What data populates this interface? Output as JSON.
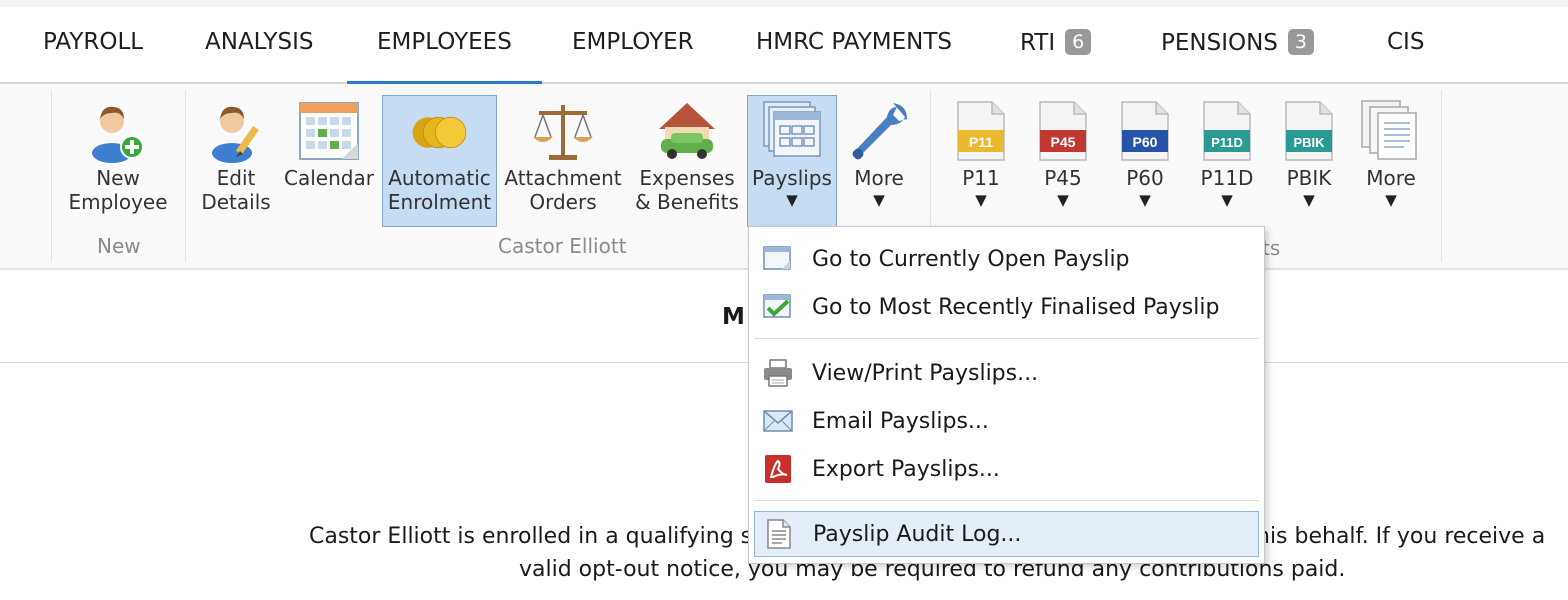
{
  "tabs": [
    {
      "label": "PAYROLL"
    },
    {
      "label": "ANALYSIS"
    },
    {
      "label": "EMPLOYEES",
      "active": true
    },
    {
      "label": "EMPLOYER"
    },
    {
      "label": "HMRC PAYMENTS"
    },
    {
      "label": "RTI",
      "badge": "6"
    },
    {
      "label": "PENSIONS",
      "badge": "3"
    },
    {
      "label": "CIS"
    }
  ],
  "ribbon": {
    "new_employee": {
      "line1": "New",
      "line2": "Employee"
    },
    "edit_details": {
      "line1": "Edit",
      "line2": "Details"
    },
    "calendar": {
      "line1": "Calendar"
    },
    "automatic_enrolment": {
      "line1": "Automatic",
      "line2": "Enrolment"
    },
    "attachment_orders": {
      "line1": "Attachment",
      "line2": "Orders"
    },
    "expenses_benefits": {
      "line1": "Expenses",
      "line2": "& Benefits"
    },
    "payslips": {
      "line1": "Payslips",
      "arrow": "▼"
    },
    "more1": {
      "line1": "More",
      "arrow": "▼"
    },
    "p11": {
      "line1": "P11",
      "icon_text": "P11",
      "color": "#e9b92e",
      "arrow": "▼"
    },
    "p45": {
      "line1": "P45",
      "icon_text": "P45",
      "color": "#c0382f",
      "arrow": "▼"
    },
    "p60": {
      "line1": "P60",
      "icon_text": "P60",
      "color": "#2554a8",
      "arrow": "▼"
    },
    "p11d": {
      "line1": "P11D",
      "icon_text": "P11D",
      "color": "#2a9a95",
      "arrow": "▼"
    },
    "pbik": {
      "line1": "PBIK",
      "icon_text": "PBIK",
      "color": "#2a9a95",
      "arrow": "▼"
    },
    "more2": {
      "line1": "More",
      "arrow": "▼"
    },
    "group_new": "New",
    "group_employee": "Castor Elliott",
    "group_forms_tail": "ts"
  },
  "menu": {
    "items": [
      {
        "label": "Go to Currently Open Payslip",
        "icon": "document-icon"
      },
      {
        "label": "Go to Most Recently Finalised Payslip",
        "icon": "check-document-icon"
      },
      {
        "label": "View/Print Payslips...",
        "icon": "printer-icon"
      },
      {
        "label": "Email Payslips...",
        "icon": "envelope-icon"
      },
      {
        "label": "Export Payslips...",
        "icon": "pdf-icon"
      },
      {
        "label": "Payslip Audit Log...",
        "icon": "log-icon"
      }
    ]
  },
  "content": {
    "heading_fragment": "M",
    "message_line1_start": "Castor Elliott is enrolled in a qualifying sc",
    "message_line1_end": "his behalf. If you receive a",
    "message_line2": "valid opt-out notice, you may be required to refund any contributions paid."
  },
  "colors": {
    "accent": "#2a7ac7",
    "active_bg": "#c6dcf2",
    "badge": "#999999"
  }
}
